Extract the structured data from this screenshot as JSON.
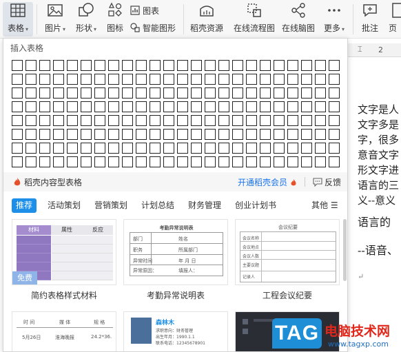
{
  "ribbon": {
    "table_label": "表格",
    "picture_label": "图片",
    "shape_label": "形状",
    "icon_label": "图标",
    "chart_label": "图表",
    "smart_shape_label": "智能图形",
    "daoke_label": "稻壳资源",
    "flowchart_label": "在线流程图",
    "mindmap_label": "在线脑图",
    "more_label": "更多",
    "comment_label": "批注",
    "page_label": "页"
  },
  "panel": {
    "title": "插入表格",
    "grid_cols": 24,
    "grid_rows": 8,
    "footer_left": "稻壳内容型表格",
    "footer_vip": "开通稻壳会员",
    "footer_feedback": "反馈"
  },
  "tabs": {
    "items": [
      "推荐",
      "活动策划",
      "营销策划",
      "计划总结",
      "财务管理",
      "创业计划书"
    ],
    "more": "其他"
  },
  "templates": [
    {
      "label": "简约表格样式材料",
      "badge": "免费",
      "head": [
        "材料",
        "属性",
        "反应"
      ]
    },
    {
      "label": "考勤异常说明表",
      "heading": "考勤异常说明表",
      "rows": [
        "部门",
        "职务",
        "异常时间",
        "异常原因："
      ],
      "fields": [
        "姓名",
        "所属部门",
        "年  月  日",
        "填报人："
      ]
    },
    {
      "label": "工程会议纪要",
      "heading": "会议纪要",
      "rows": [
        "会议名称",
        "会议地点",
        "会议人数",
        "主要议题",
        "记录人"
      ]
    }
  ],
  "templates_row2": [
    {
      "head": [
        "时 间",
        "媒 体",
        "规 格"
      ],
      "row": [
        "5月26日",
        "淮海晚报",
        "24.2*36."
      ]
    },
    {
      "name": "森林木",
      "lines": [
        "求职意向：财务管理",
        "出生年月：1990.1.1",
        "联系电话：12345678901"
      ]
    },
    {
      "dark": true
    }
  ],
  "document": {
    "ruler_mark": "2",
    "lines": [
      "文字是人",
      "文字多是",
      "字，很多",
      "意音文字",
      "形文字进",
      "语言的三",
      "义--意义",
      "语言的",
      "--语音、"
    ]
  },
  "watermark": {
    "logo": "TAG",
    "title": "电脑技术网",
    "url": "www.tagxp.com"
  },
  "colors": {
    "accent": "#1e8fe8",
    "vip": "#1a73e8",
    "badge": "#8fb4e8",
    "card1_header": "#a48ccf"
  }
}
